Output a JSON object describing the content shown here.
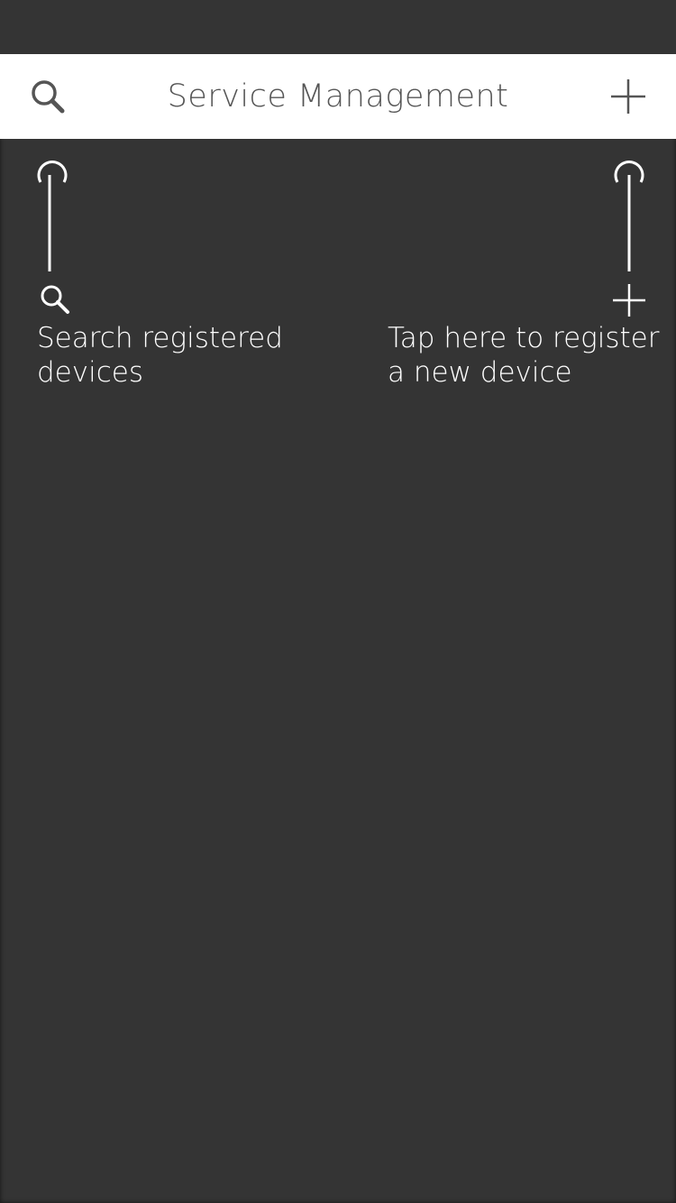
{
  "colors": {
    "background": "#343434",
    "header_background": "#ffffff",
    "header_text": "#555555",
    "hint_text": "#ffffff"
  },
  "header": {
    "title": "Service Management",
    "search_icon": "search-icon",
    "add_icon": "plus-icon"
  },
  "hints": {
    "search": {
      "text": "Search registered\ndevices",
      "icon": "search-icon"
    },
    "add": {
      "text": "Tap here to register\na new device",
      "icon": "plus-icon"
    }
  }
}
